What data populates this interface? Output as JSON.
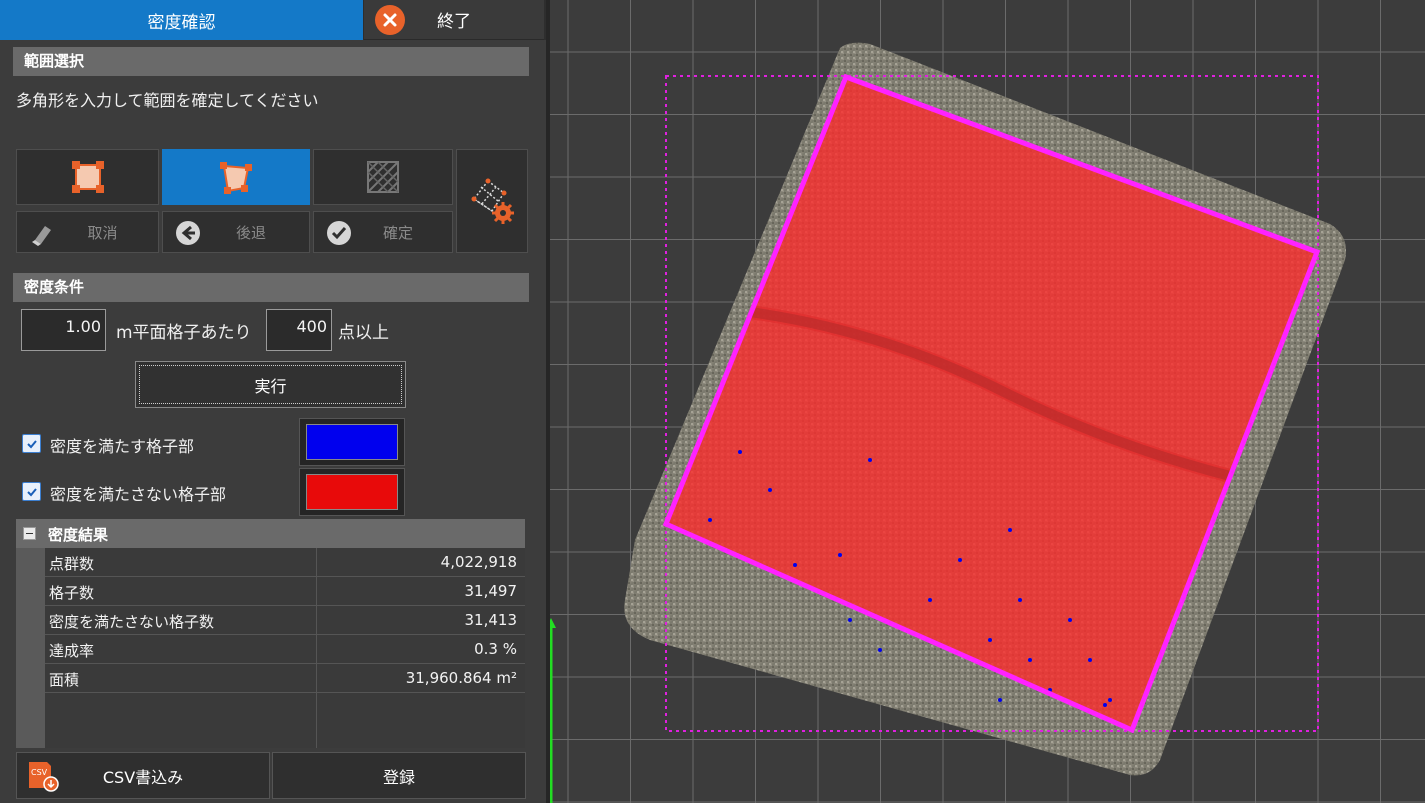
{
  "tabs": {
    "active_label": "密度確認",
    "close_label": "終了"
  },
  "range": {
    "section_title": "範囲選択",
    "hint": "多角形を入力して範囲を確定してください",
    "buttons": {
      "cancel": "取消",
      "back": "後退",
      "confirm": "確定"
    }
  },
  "conditions": {
    "section_title": "密度条件",
    "grid_size": "1.00",
    "grid_label": "m平面格子あたり",
    "min_points": "400",
    "points_label": "点以上",
    "run_label": "実行",
    "show_ok_label": "密度を満たす格子部",
    "show_ng_label": "密度を満たさない格子部",
    "ok_color": "#0000ee",
    "ng_color": "#e80a0a"
  },
  "results": {
    "section_title": "密度結果",
    "rows": [
      {
        "key": "点群数",
        "value": "4,022,918"
      },
      {
        "key": "格子数",
        "value": "31,497"
      },
      {
        "key": "密度を満たさない格子数",
        "value": "31,413"
      },
      {
        "key": "達成率",
        "value": "0.3 %"
      },
      {
        "key": "面積",
        "value": "31,960.864 m²"
      }
    ]
  },
  "footer": {
    "csv_label": "CSV書込み",
    "csv_badge": "CSV",
    "register_label": "登録"
  },
  "viewport": {
    "polygon_color": "#ff22ff",
    "fill_color": "#ff2a2a",
    "bbox_color": "#e020e0",
    "axis_color": "#22dd22"
  }
}
